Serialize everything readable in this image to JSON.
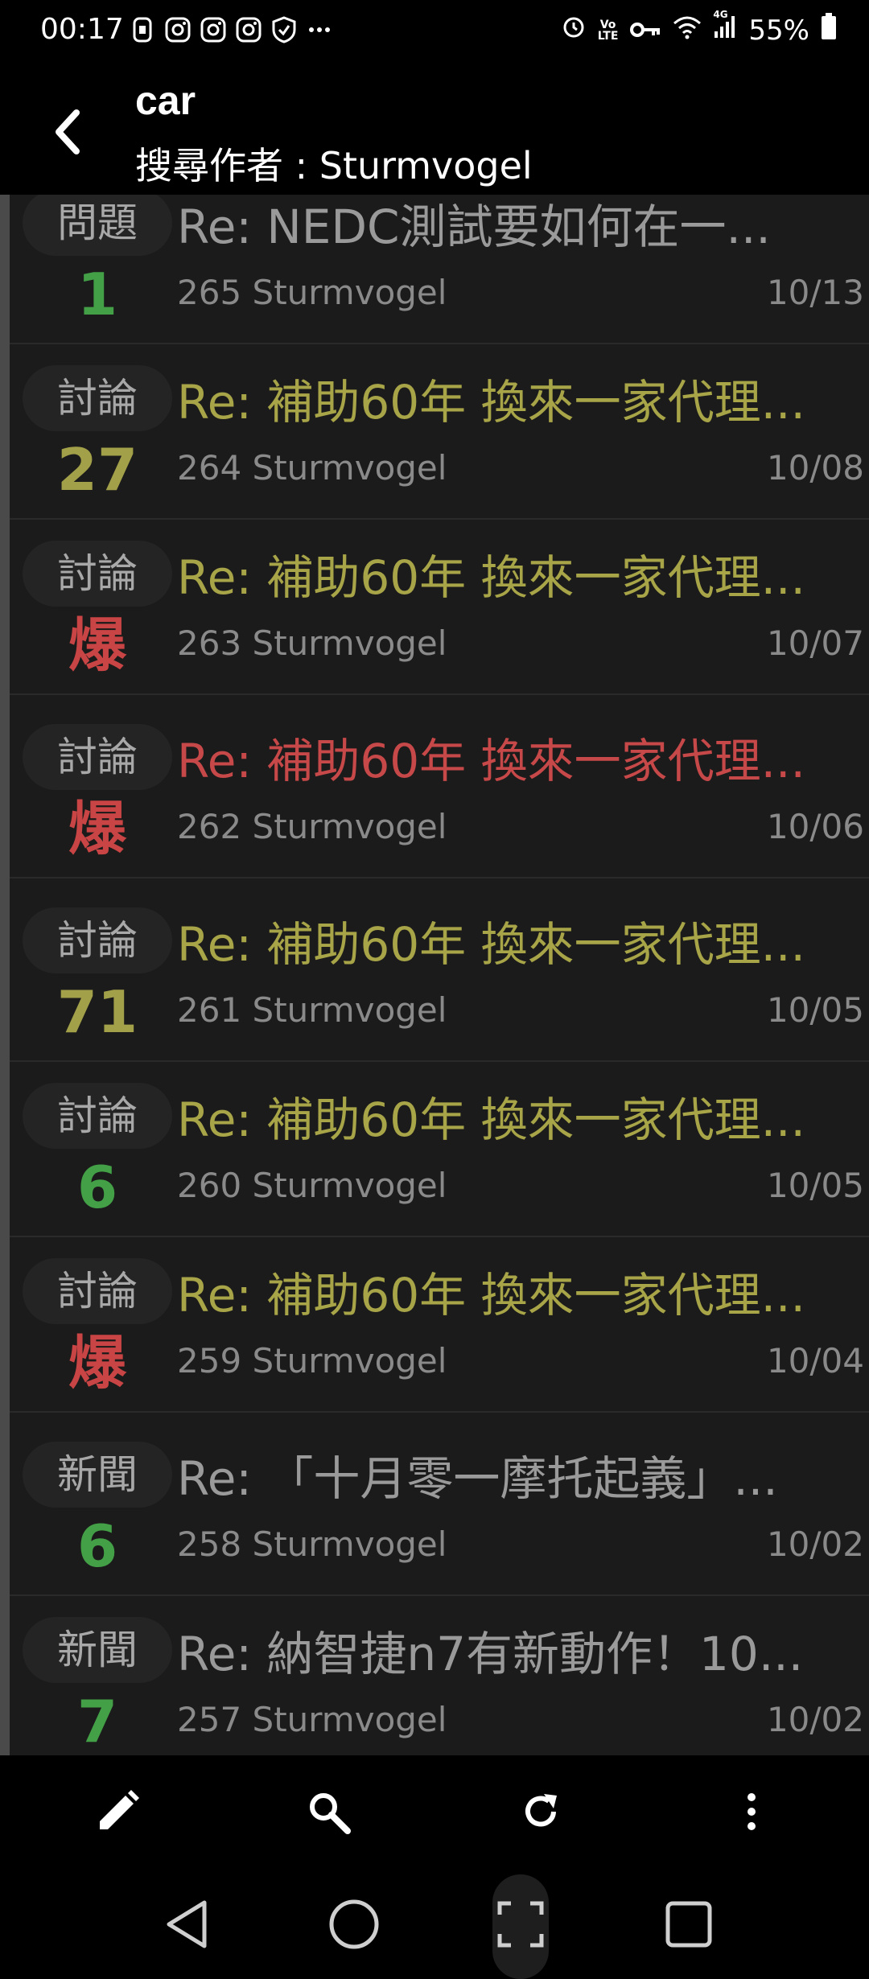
{
  "status_bar": {
    "time": "00:17",
    "battery": "55%",
    "network": "4G",
    "icons_left": [
      "b-icon",
      "instagram-icon",
      "instagram-icon",
      "instagram-icon",
      "shield-check-icon",
      "more-dots-icon"
    ],
    "icons_right": [
      "alarm-icon",
      "volte-icon",
      "key-icon",
      "wifi-icon",
      "signal-icon",
      "battery-icon"
    ]
  },
  "app_bar": {
    "title": "car",
    "subtitle": "搜尋作者 : Sturmvogel"
  },
  "colors": {
    "green": "#43a047",
    "olive": "#a3a04a",
    "red": "#c94545",
    "background": "#1b1b1b"
  },
  "posts": [
    {
      "category": "問題",
      "count": "1",
      "count_color": "green",
      "title": "Re: NEDC測試要如何在一...",
      "title_color": "gray",
      "number": "265",
      "author": "Sturmvogel",
      "date": "10/13"
    },
    {
      "category": "討論",
      "count": "27",
      "count_color": "olive",
      "title": "Re: 補助60年 換來一家代理...",
      "title_color": "olive",
      "number": "264",
      "author": "Sturmvogel",
      "date": "10/08"
    },
    {
      "category": "討論",
      "count": "爆",
      "count_color": "red",
      "title": "Re: 補助60年 換來一家代理...",
      "title_color": "olive",
      "number": "263",
      "author": "Sturmvogel",
      "date": "10/07"
    },
    {
      "category": "討論",
      "count": "爆",
      "count_color": "red",
      "title": "Re: 補助60年 換來一家代理...",
      "title_color": "red",
      "number": "262",
      "author": "Sturmvogel",
      "date": "10/06"
    },
    {
      "category": "討論",
      "count": "71",
      "count_color": "olive",
      "title": "Re: 補助60年 換來一家代理...",
      "title_color": "olive",
      "number": "261",
      "author": "Sturmvogel",
      "date": "10/05"
    },
    {
      "category": "討論",
      "count": "6",
      "count_color": "green",
      "title": "Re: 補助60年 換來一家代理...",
      "title_color": "olive",
      "number": "260",
      "author": "Sturmvogel",
      "date": "10/05"
    },
    {
      "category": "討論",
      "count": "爆",
      "count_color": "red",
      "title": "Re: 補助60年 換來一家代理...",
      "title_color": "olive",
      "number": "259",
      "author": "Sturmvogel",
      "date": "10/04"
    },
    {
      "category": "新聞",
      "count": "6",
      "count_color": "green",
      "title": "Re: 「十月零一摩托起義」...",
      "title_color": "gray",
      "number": "258",
      "author": "Sturmvogel",
      "date": "10/02"
    },
    {
      "category": "新聞",
      "count": "7",
      "count_color": "green",
      "title": "Re: 納智捷n7有新動作！10...",
      "title_color": "gray",
      "number": "257",
      "author": "Sturmvogel",
      "date": "10/02"
    }
  ],
  "toolbar": {
    "buttons": [
      "pencil-icon",
      "search-icon",
      "refresh-icon",
      "more-vert-icon"
    ]
  },
  "nav_bar": {
    "buttons": [
      "back-triangle-icon",
      "home-circle-icon",
      "screenshot-frame-icon",
      "recents-square-icon"
    ]
  }
}
